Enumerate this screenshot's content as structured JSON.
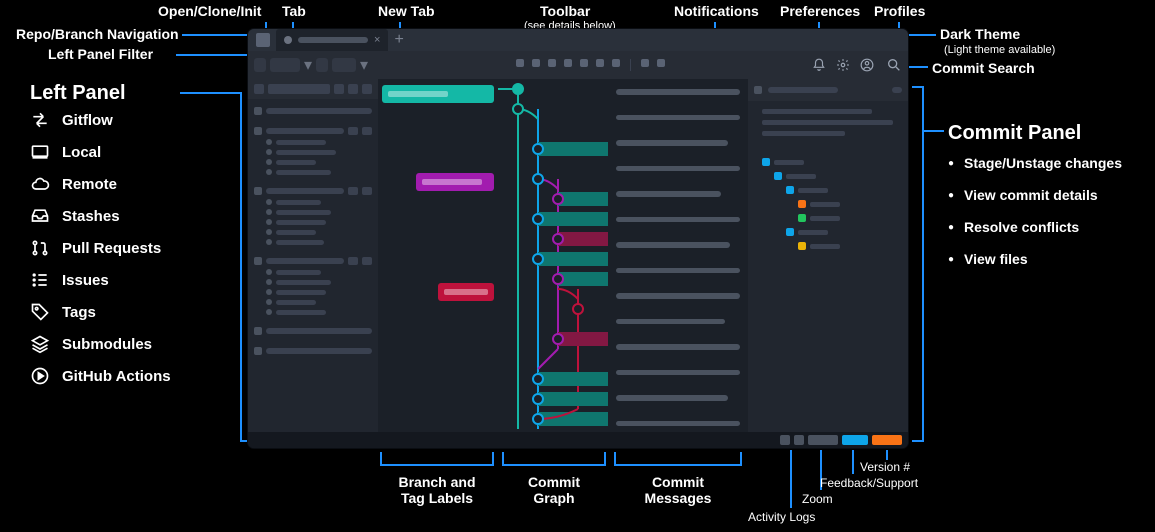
{
  "annotations": {
    "open_clone_init": "Open/Clone/Init",
    "tab": "Tab",
    "new_tab": "New Tab",
    "toolbar": "Toolbar",
    "toolbar_sub": "(see details below)",
    "notifications": "Notifications",
    "preferences": "Preferences",
    "profiles": "Profiles",
    "dark_theme": "Dark Theme",
    "dark_theme_sub": "(Light theme available)",
    "commit_search": "Commit Search",
    "repo_branch_nav": "Repo/Branch Navigation",
    "left_panel_filter": "Left Panel Filter",
    "left_panel_heading": "Left Panel",
    "commit_panel_heading": "Commit Panel",
    "branch_tag_labels": "Branch and\nTag Labels",
    "commit_graph": "Commit\nGraph",
    "commit_messages": "Commit\nMessages",
    "activity_logs": "Activity Logs",
    "zoom": "Zoom",
    "feedback_support": "Feedback/Support",
    "version_no": "Version #"
  },
  "left_panel_items": [
    "Gitflow",
    "Local",
    "Remote",
    "Stashes",
    "Pull Requests",
    "Issues",
    "Tags",
    "Submodules",
    "GitHub Actions"
  ],
  "commit_panel_items": [
    "Stage/Unstage changes",
    "View commit details",
    "Resolve conflicts",
    "View files"
  ],
  "graph_colors": {
    "teal": "#14b8a6",
    "teal_dark": "#0f766e",
    "magenta": "#a21caf",
    "rose": "#be123c",
    "blue": "#0ea5e9",
    "orange": "#f97316",
    "yellow": "#eab308",
    "green": "#22c55e",
    "gray": "#6b7280"
  }
}
